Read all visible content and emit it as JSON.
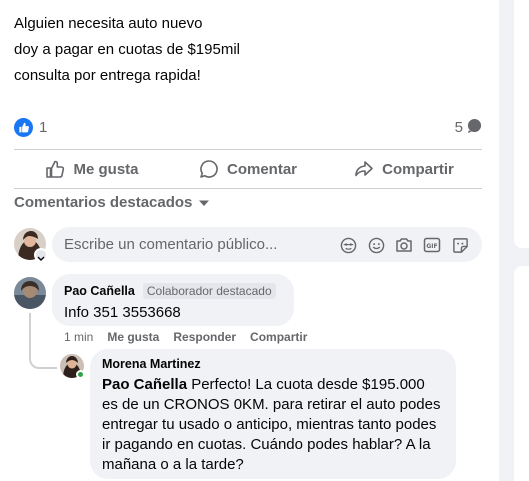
{
  "post": {
    "lines": [
      "Alguien necesita auto nuevo",
      "doy a pagar en cuotas de $195mil",
      "consulta por entrega rapida!"
    ],
    "reaction_count": "1",
    "comment_count": "5"
  },
  "actions": {
    "like": "Me gusta",
    "comment": "Comentar",
    "share": "Compartir"
  },
  "filter_label": "Comentarios destacados",
  "composer": {
    "placeholder": "Escribe un comentario público..."
  },
  "comments": [
    {
      "author": "Pao Cañella",
      "badge": "Colaborador destacado",
      "text": "Info 351 3553668",
      "time": "1 min",
      "like_label": "Me gusta",
      "reply_label": "Responder",
      "share_label": "Compartir"
    }
  ],
  "reply": {
    "author": "Morena Martinez",
    "mention": "Pao Cañella",
    "text": " Perfecto! La cuota desde $195.000 es de un CRONOS 0KM. para retirar el auto podes entregar tu usado o anticipo, mientras tanto podes ir pagando en cuotas. Cuándo podes hablar? A la mañana o a la tarde?"
  },
  "colors": {
    "accent": "#1877f2",
    "secondary_text": "#65676b",
    "bubble_bg": "#f0f2f5",
    "online": "#31a24c"
  }
}
